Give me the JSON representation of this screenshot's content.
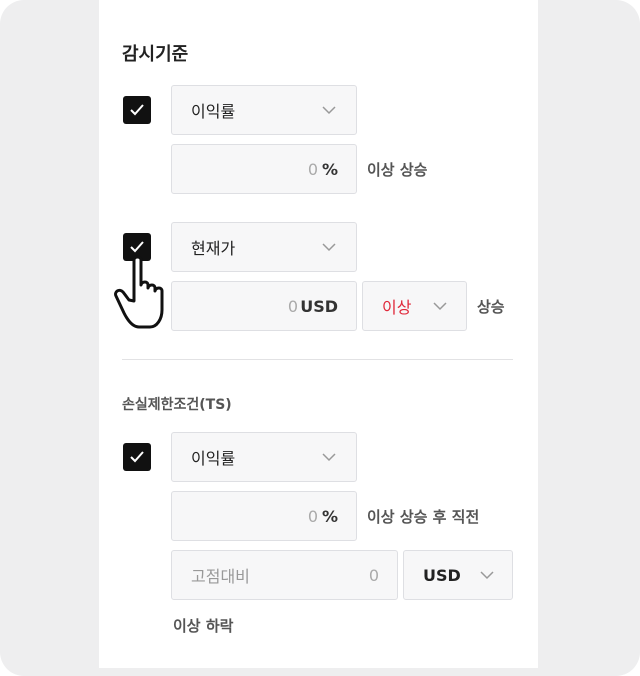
{
  "monitor": {
    "title": "감시기준",
    "rule1": {
      "checked": true,
      "select": "이익률",
      "value": "0",
      "unit": "%",
      "suffix": "이상 상승"
    },
    "rule2": {
      "checked": true,
      "select": "현재가",
      "value": "0",
      "unit": "USD",
      "compare": "이상",
      "suffix": "상승"
    }
  },
  "stoploss": {
    "title": "손실제한조건(TS)",
    "rule1": {
      "checked": true,
      "select": "이익률",
      "value": "0",
      "unit": "%",
      "suffix": "이상 상승 후 직전"
    },
    "rule2": {
      "placeholder": "고점대비",
      "value": "0",
      "currency": "USD",
      "suffix": "이상 하락"
    }
  },
  "colors": {
    "accent_red": "#e0283a",
    "checkbox": "#111111"
  },
  "icons": {
    "checkbox": "check-icon",
    "dropdown": "chevron-down-icon",
    "cursor": "hand-pointer-icon"
  }
}
